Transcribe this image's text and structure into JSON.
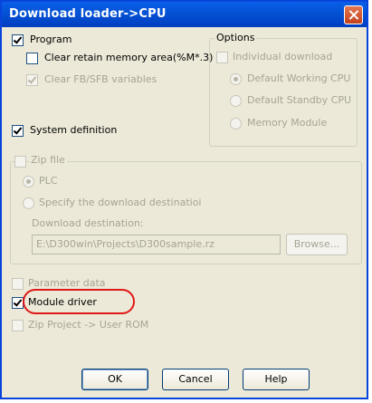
{
  "dialog": {
    "title": "Download loader->CPU",
    "close_label": ""
  },
  "program": {
    "label": "Program",
    "checked": true,
    "clear_retain": "Clear retain memory area(%M*.3)",
    "clear_fb": "Clear FB/SFB variables"
  },
  "options": {
    "title": "Options",
    "individual_download": "Individual download",
    "default_working_cpu": "Default Working CPU",
    "default_standby_cpu": "Default Standby CPU",
    "memory_module": "Memory Module"
  },
  "system_definition": {
    "label": "System definition",
    "checked": true
  },
  "zip_file": {
    "label": "Zip file",
    "plc": "PLC",
    "specify_destination": "Specify the download destinatioi",
    "download_destination_label": "Download destination:",
    "download_destination_value": "E:\\D300win\\Projects\\D300sample.rz",
    "browse": "Browse..."
  },
  "parameter_data": {
    "label": "Parameter data"
  },
  "module_driver": {
    "label": "Module driver",
    "checked": true
  },
  "zip_project": {
    "label": "Zip Project -> User ROM"
  },
  "buttons": {
    "ok": "OK",
    "cancel": "Cancel",
    "help": "Help"
  },
  "colors": {
    "titlebar": "#0453d6",
    "dialog_bg": "#ece9d8",
    "highlight": "#e01818",
    "disabled_text": "#a7a492"
  }
}
